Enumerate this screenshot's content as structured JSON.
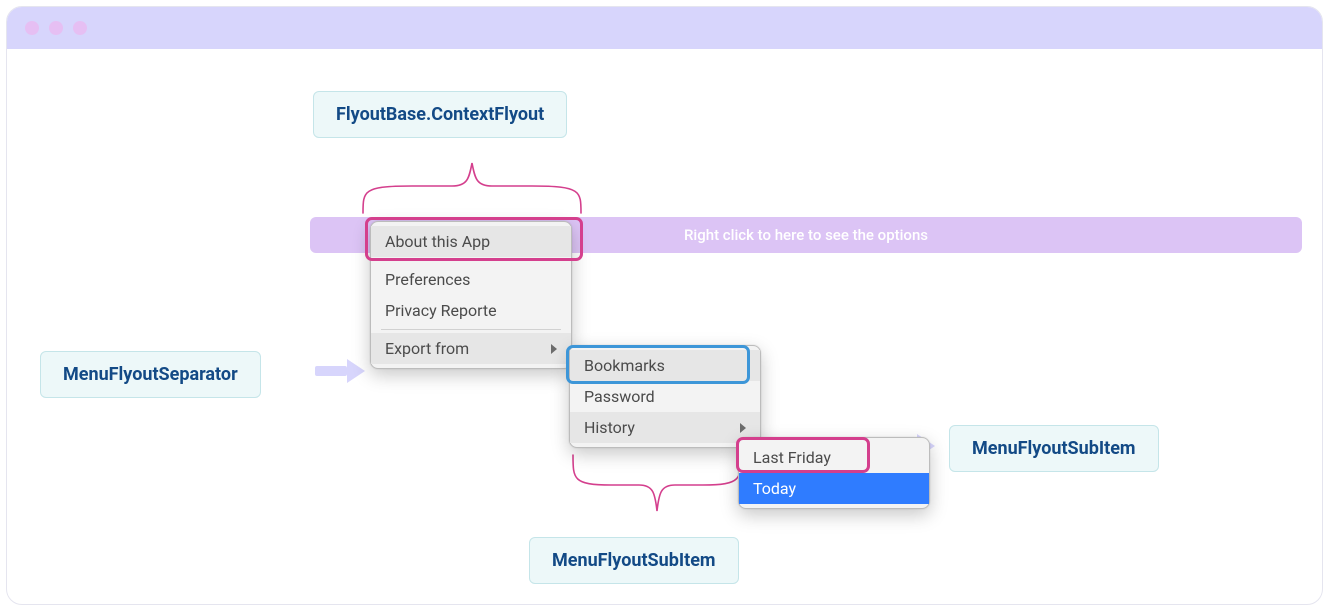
{
  "labels": {
    "context": "FlyoutBase.ContextFlyout",
    "separator": "MenuFlyoutSeparator",
    "subitem_a": "MenuFlyoutSubItem",
    "subitem_b": "MenuFlyoutSubItem"
  },
  "bar": {
    "text": "Right click to here to see the options"
  },
  "menu1": {
    "items": [
      "About this App",
      "Preferences",
      "Privacy Reporte",
      "Export from"
    ]
  },
  "menu2": {
    "items": [
      "Bookmarks",
      "Password",
      "History"
    ]
  },
  "menu3": {
    "items": [
      "Last Friday",
      "Today"
    ]
  }
}
